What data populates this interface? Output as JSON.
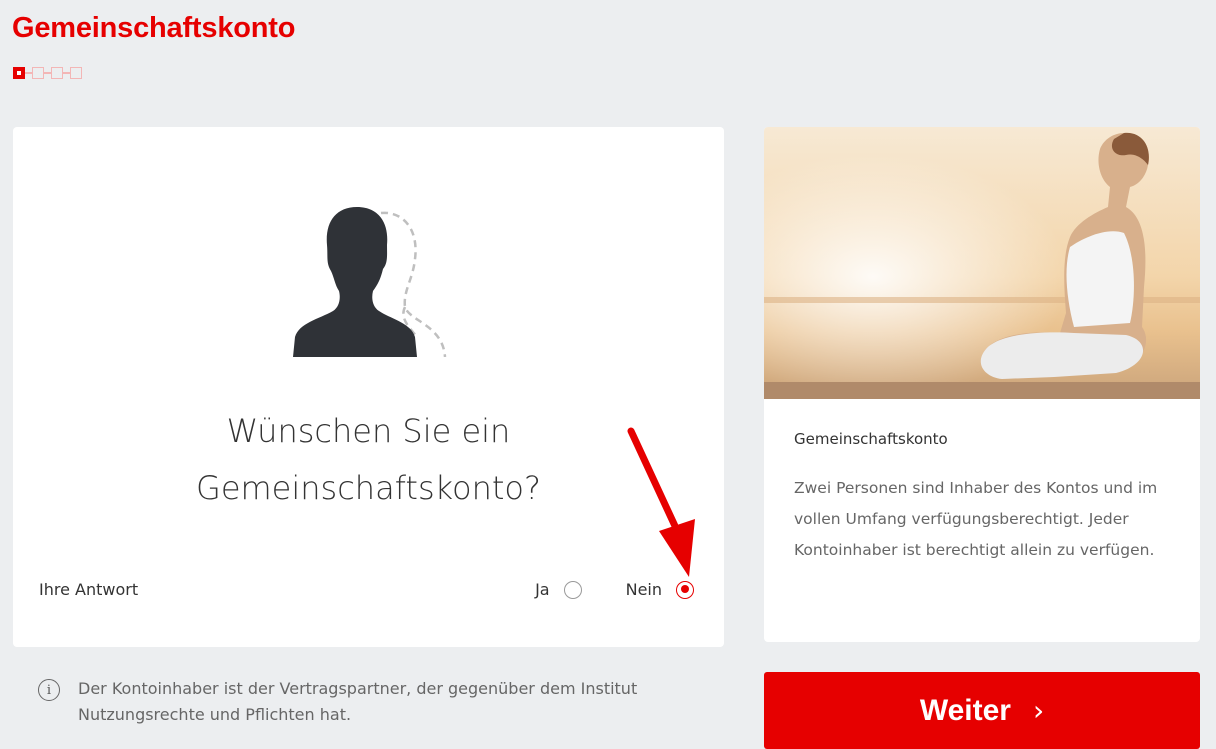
{
  "header": {
    "title": "Gemeinschaftskonto"
  },
  "stepper": {
    "total_steps": 4,
    "current_step": 1
  },
  "question": {
    "line1": "Wünschen Sie ein",
    "line2": "Gemeinschaftskonto?"
  },
  "answer": {
    "label": "Ihre Antwort",
    "options": [
      {
        "label": "Ja",
        "selected": false
      },
      {
        "label": "Nein",
        "selected": true
      }
    ]
  },
  "info": {
    "icon": "info-icon",
    "icon_glyph": "i",
    "text": "Der Kontoinhaber ist der Vertragspartner, der gegenüber dem Institut Nutzungsrechte und Pflichten hat."
  },
  "sidecard": {
    "title": "Gemeinschaftskonto",
    "text": "Zwei Personen sind Inhaber des Kontos und im vollen Umfang verfügungsberechtigt. Jeder Kontoinhaber ist berechtigt allein zu verfügen."
  },
  "next_button": {
    "label": "Weiter",
    "chevron": "›"
  },
  "colors": {
    "accent": "#e60000",
    "background": "#eceef0"
  }
}
